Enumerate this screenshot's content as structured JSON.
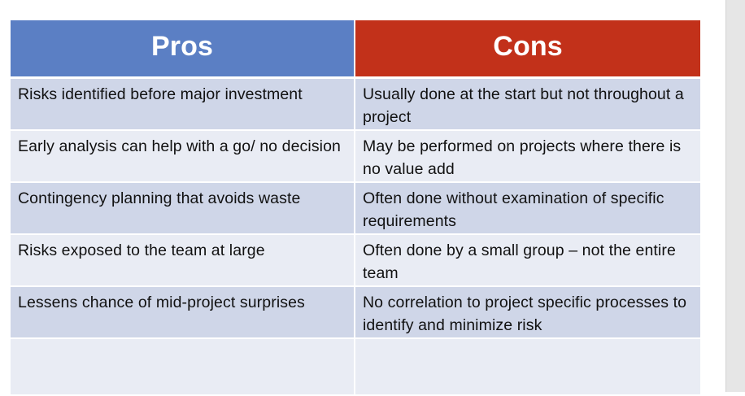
{
  "table": {
    "headers": {
      "pros": "Pros",
      "cons": "Cons"
    },
    "rows": [
      {
        "pro": "Risks identified before major investment",
        "con": "Usually done at the start but not throughout a project"
      },
      {
        "pro": "Early analysis can help with a go/ no decision",
        "con": "May be performed on projects where there is no value add"
      },
      {
        "pro": "Contingency planning that avoids waste",
        "con": "Often done without examination of specific requirements"
      },
      {
        "pro": "Risks exposed to the team at large",
        "con": "Often done by a small group – not the entire team"
      },
      {
        "pro": "Lessens chance of mid-project surprises",
        "con": "No correlation to project specific processes to identify and minimize risk"
      },
      {
        "pro": "",
        "con": ""
      }
    ]
  },
  "colors": {
    "pros_header": "#5b7fc4",
    "cons_header": "#c2311a",
    "row_dark": "#cfd6e8",
    "row_light": "#e9ecf4"
  }
}
